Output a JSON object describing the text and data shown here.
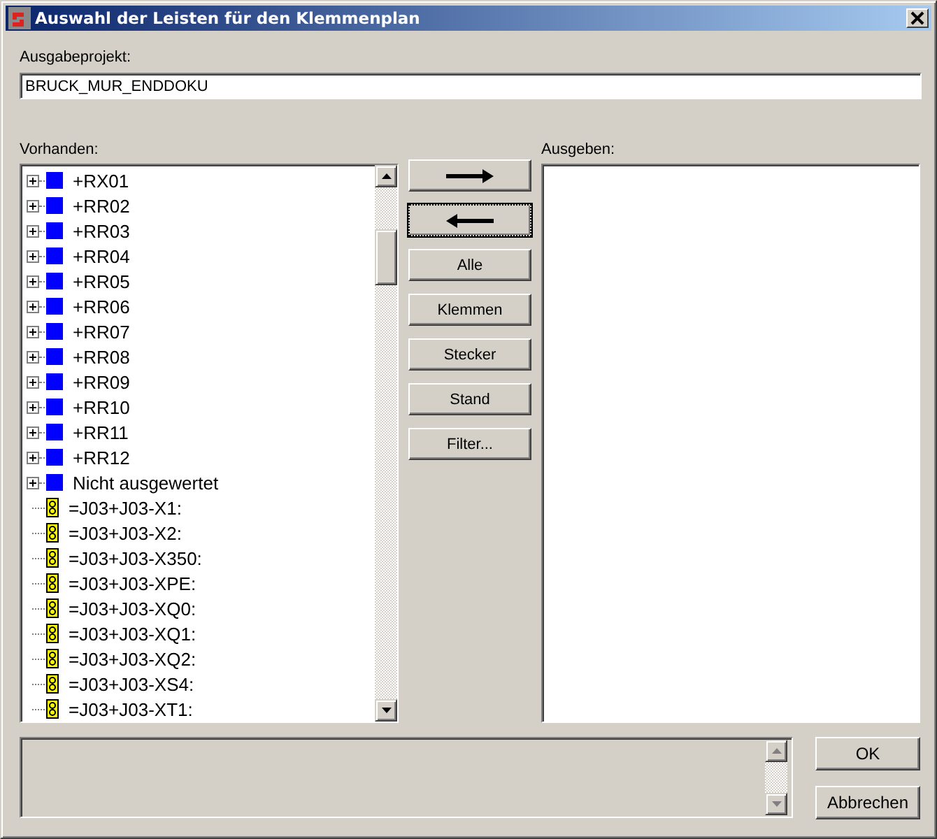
{
  "window": {
    "title": "Auswahl der Leisten für den Klemmenplan"
  },
  "project": {
    "label": "Ausgabeprojekt:",
    "value": "BRUCK_MUR_ENDDOKU"
  },
  "available": {
    "label": "Vorhanden:",
    "items": [
      {
        "kind": "group",
        "label": "+RX01"
      },
      {
        "kind": "group",
        "label": "+RR02"
      },
      {
        "kind": "group",
        "label": "+RR03"
      },
      {
        "kind": "group",
        "label": "+RR04"
      },
      {
        "kind": "group",
        "label": "+RR05"
      },
      {
        "kind": "group",
        "label": "+RR06"
      },
      {
        "kind": "group",
        "label": "+RR07"
      },
      {
        "kind": "group",
        "label": "+RR08"
      },
      {
        "kind": "group",
        "label": "+RR09"
      },
      {
        "kind": "group",
        "label": "+RR10"
      },
      {
        "kind": "group",
        "label": "+RR11"
      },
      {
        "kind": "group",
        "label": "+RR12"
      },
      {
        "kind": "group",
        "label": "Nicht ausgewertet"
      },
      {
        "kind": "terminal",
        "label": "=J03+J03-X1:"
      },
      {
        "kind": "terminal",
        "label": "=J03+J03-X2:"
      },
      {
        "kind": "terminal",
        "label": "=J03+J03-X350:"
      },
      {
        "kind": "terminal",
        "label": "=J03+J03-XPE:"
      },
      {
        "kind": "terminal",
        "label": "=J03+J03-XQ0:"
      },
      {
        "kind": "terminal",
        "label": "=J03+J03-XQ1:"
      },
      {
        "kind": "terminal",
        "label": "=J03+J03-XQ2:"
      },
      {
        "kind": "terminal",
        "label": "=J03+J03-XS4:"
      },
      {
        "kind": "terminal",
        "label": "=J03+J03-XT1:"
      }
    ]
  },
  "middle_buttons": [
    {
      "kind": "arrow-right",
      "focused": false
    },
    {
      "kind": "arrow-left",
      "focused": true
    },
    {
      "kind": "text",
      "label": "Alle",
      "focused": false
    },
    {
      "kind": "text",
      "label": "Klemmen",
      "focused": false
    },
    {
      "kind": "text",
      "label": "Stecker",
      "focused": false
    },
    {
      "kind": "text",
      "label": "Stand",
      "focused": false
    },
    {
      "kind": "text",
      "label": "Filter...",
      "focused": false
    }
  ],
  "output": {
    "label": "Ausgeben:"
  },
  "buttons": [
    "OK",
    "Abbrechen"
  ]
}
